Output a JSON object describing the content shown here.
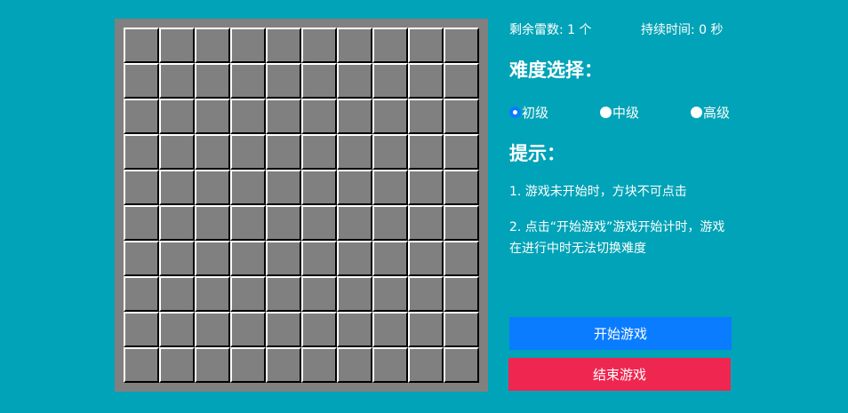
{
  "board": {
    "rows": 10,
    "cols": 10
  },
  "stats": {
    "mines_label": "剩余雷数: 1 个",
    "time_label": "持续时间: 0 秒"
  },
  "difficulty": {
    "title": "难度选择：",
    "options": [
      {
        "label": "初级",
        "selected": true
      },
      {
        "label": "中级",
        "selected": false
      },
      {
        "label": "高级",
        "selected": false
      }
    ]
  },
  "tips": {
    "title": "提示：",
    "items": [
      "1. 游戏未开始时，方块不可点击",
      "2. 点击“开始游戏”游戏开始计时，游戏在进行中时无法切换难度"
    ]
  },
  "buttons": {
    "start": "开始游戏",
    "end": "结束游戏"
  },
  "colors": {
    "background": "#00a3b7",
    "start": "#0a7cff",
    "end": "#ef264f"
  }
}
